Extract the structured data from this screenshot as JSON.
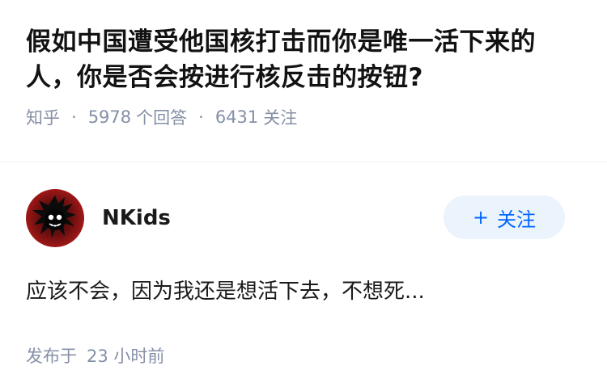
{
  "question": {
    "title": "假如中国遭受他国核打击而你是唯一活下来的人，你是否会按进行核反击的按钮?",
    "source": "知乎",
    "answer_count": "5978",
    "answer_label": "个回答",
    "follow_count": "6431",
    "follow_label": "关注"
  },
  "answer": {
    "author": "NKids",
    "follow_button": "关注",
    "text": "应该不会，因为我还是想活下去，不想死...",
    "time_prefix": "发布于",
    "time_value": "23 小时前"
  },
  "colors": {
    "meta_gray": "#8590a6",
    "accent_blue": "#0066ff",
    "button_bg": "#ebf3fd"
  }
}
